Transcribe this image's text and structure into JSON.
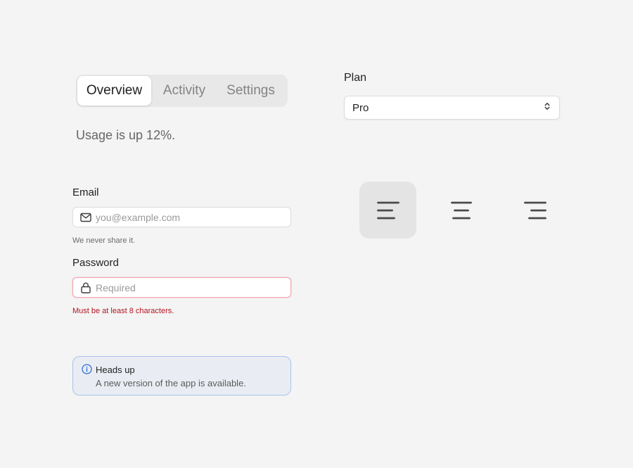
{
  "tabs": {
    "items": [
      {
        "label": "Overview",
        "active": true
      },
      {
        "label": "Activity",
        "active": false
      },
      {
        "label": "Settings",
        "active": false
      }
    ],
    "panel_text": "Usage is up 12%."
  },
  "email": {
    "label": "Email",
    "placeholder": "you@example.com",
    "value": "",
    "help": "We never share it.",
    "icon": "mail-icon"
  },
  "password": {
    "label": "Password",
    "placeholder": "Required",
    "value": "",
    "error": "Must be at least 8 characters.",
    "icon": "lock-icon"
  },
  "alert": {
    "title": "Heads up",
    "body": "A new version of the app is available.",
    "icon": "info-icon",
    "accent": "#2f6fd6"
  },
  "plan": {
    "label": "Plan",
    "value": "Pro",
    "icon": "chevron-up-down-icon"
  },
  "alignment": {
    "selected": "left",
    "options": [
      {
        "value": "left",
        "icon": "align-left-icon"
      },
      {
        "value": "center",
        "icon": "align-center-icon"
      },
      {
        "value": "right",
        "icon": "align-right-icon"
      }
    ]
  },
  "colors": {
    "background": "#f4f4f4",
    "error": "#b3141f",
    "alert_border": "#a9c3ea",
    "alert_bg": "#e9edf3"
  }
}
